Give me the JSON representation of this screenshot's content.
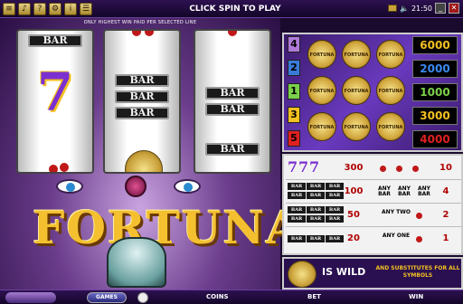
{
  "header": {
    "title": "CLICK SPIN TO PLAY",
    "clock": "21:50",
    "notice": "ONLY HIGHEST WIN PAID PER SELECTED LINE",
    "icons": [
      "menu-icon",
      "sound-icon",
      "help-icon",
      "settings-icon",
      "info-icon",
      "list-icon"
    ]
  },
  "reels": {
    "bar_label": "BAR",
    "seven_label": "7"
  },
  "logo": {
    "text": "FORTUNA"
  },
  "paylines": {
    "lines": [
      "4",
      "2",
      "1",
      "3",
      "5"
    ],
    "payouts": [
      "6000",
      "2000",
      "1000",
      "3000",
      "4000"
    ],
    "coin_label": "FORTUNA",
    "colors": {
      "line1": "#7bd04a",
      "line2": "#3a7ad8",
      "line3": "#f2c020",
      "line4": "#b07ad8",
      "line5": "#e02020"
    }
  },
  "paytable": {
    "rows": [
      {
        "left": "300",
        "right": "10"
      },
      {
        "left": "100",
        "right": "4"
      },
      {
        "left": "50",
        "right": "2"
      },
      {
        "left": "20",
        "right": "1"
      }
    ],
    "any_bar": "ANY BAR",
    "any_two": "ANY TWO",
    "any_one": "ANY ONE",
    "seven": "7"
  },
  "wild": {
    "label": "IS WILD",
    "substitutes": "AND SUBSTITUTES FOR ALL SYMBOLS"
  },
  "footer": {
    "games": "GAMES",
    "coins": "COINS",
    "bet": "BET",
    "win": "WIN"
  }
}
